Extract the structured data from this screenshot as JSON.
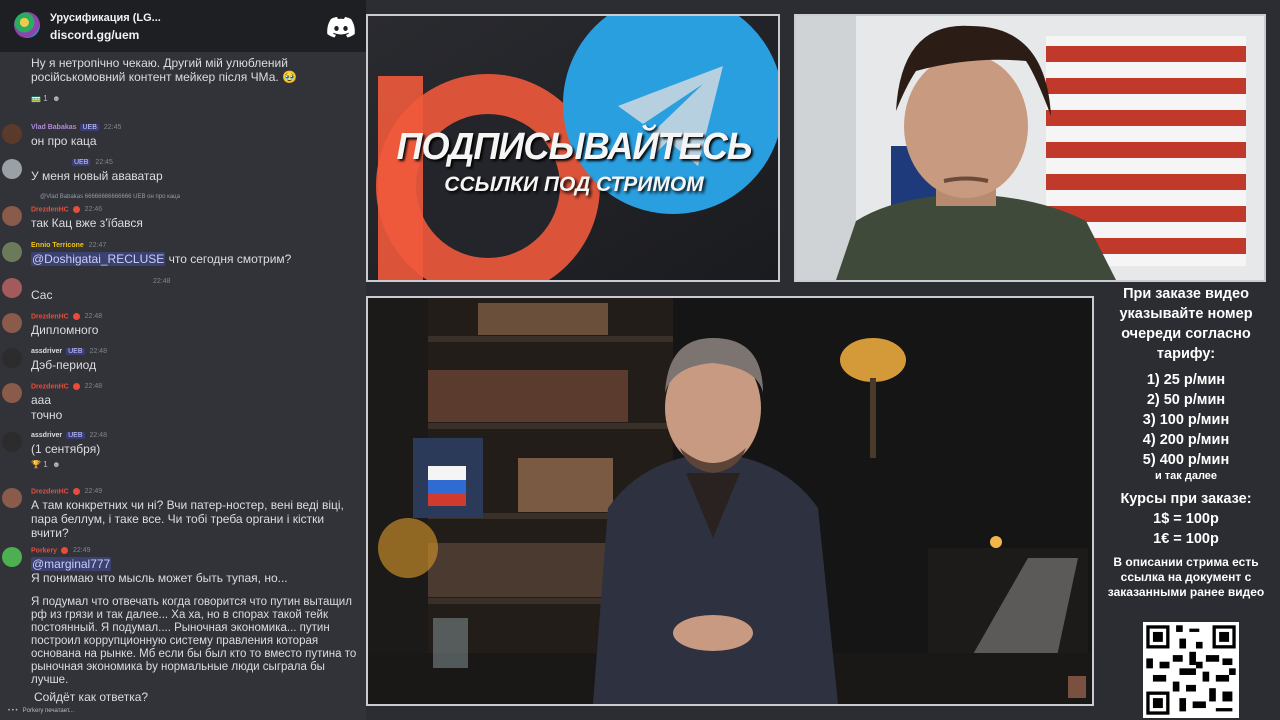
{
  "server": {
    "name": "Урусификация (LG...",
    "invite": "discord.gg/uem"
  },
  "chat": {
    "m0": {
      "text": "Ну я нетропічно чекаю. Другий мій улюблений російськомовний контент мейкер після ЧМа. 🥹",
      "reaction": "1"
    },
    "m1": {
      "name": "Vlad Babakas",
      "badge": "UEB",
      "time": "22:45",
      "text": "он про каца"
    },
    "m2": {
      "badge": "UEB",
      "time": "22:45",
      "text": "У меня новый ававатар"
    },
    "m3": {
      "reply": "@Vlad Babakas 66666666666666 UEB он про каца",
      "name": "DrezdenHC",
      "time": "22:46",
      "text": "так Кац вже з'їбався"
    },
    "m4": {
      "name": "Ennio Terricone",
      "time": "22:47",
      "mention": "@Doshigatai_RECLUSE",
      "text": "что сегодня смотрим?"
    },
    "m5": {
      "time": "22:48",
      "text": "Сас"
    },
    "m6": {
      "name": "DrezdenHC",
      "time": "22:48",
      "text": "Дипломного"
    },
    "m7": {
      "name": "assdriver",
      "badge": "UEB",
      "time": "22:48",
      "text": "Дэб-период"
    },
    "m8": {
      "name": "DrezdenHC",
      "time": "22:48",
      "text1": "ааа",
      "text2": "точно"
    },
    "m9": {
      "name": "assdriver",
      "badge": "UEB",
      "time": "22:48",
      "text": "(1 сентября)",
      "reaction": "1"
    },
    "m10": {
      "name": "DrezdenHC",
      "time": "22:49",
      "text": "А там конкретних чи ні? Вчи патер-ностер, вені веді віці, пара беллум, і таке все. Чи тобі треба органи і кістки вчити?"
    },
    "m11": {
      "name": "Porkery",
      "time": "22:49",
      "mention": "@marginal777",
      "text1": "Я понимаю что мысль может быть тупая, но...",
      "text2": "Я подумал что отвечать когда говорится что путин вытащил рф из грязи и так далее... Ха ха, но в спорах такой тейк постоянный. Я подумал.... Рыночная экономика... путин построил коррупционную систему правления которая основана на рынке. Мб если бы был кто то вместо путина то рыночная экономика by нормальные люди сыграла бы лучше.",
      "text3": "Сойдёт как ответка?"
    },
    "typing": "Porkery печатает..."
  },
  "promo": {
    "title": "ПОДПИСЫВАЙТЕСЬ",
    "subtitle": "ССЫЛКИ ПОД СТРИМОМ"
  },
  "info": {
    "order": "При заказе видео указывайте номер очереди согласно тарифу:",
    "tariffs": [
      "1) 25 р/мин",
      "2) 50 р/мин",
      "3) 100 р/мин",
      "4) 200 р/мин",
      "5) 400 р/мин"
    ],
    "etc": "и так далее",
    "rates_title": "Курсы при заказе:",
    "rate1": "1$ = 100р",
    "rate2": "1€ = 100р",
    "doc": "В описании стрима есть ссылка на документ с заказанными ранее видео"
  }
}
